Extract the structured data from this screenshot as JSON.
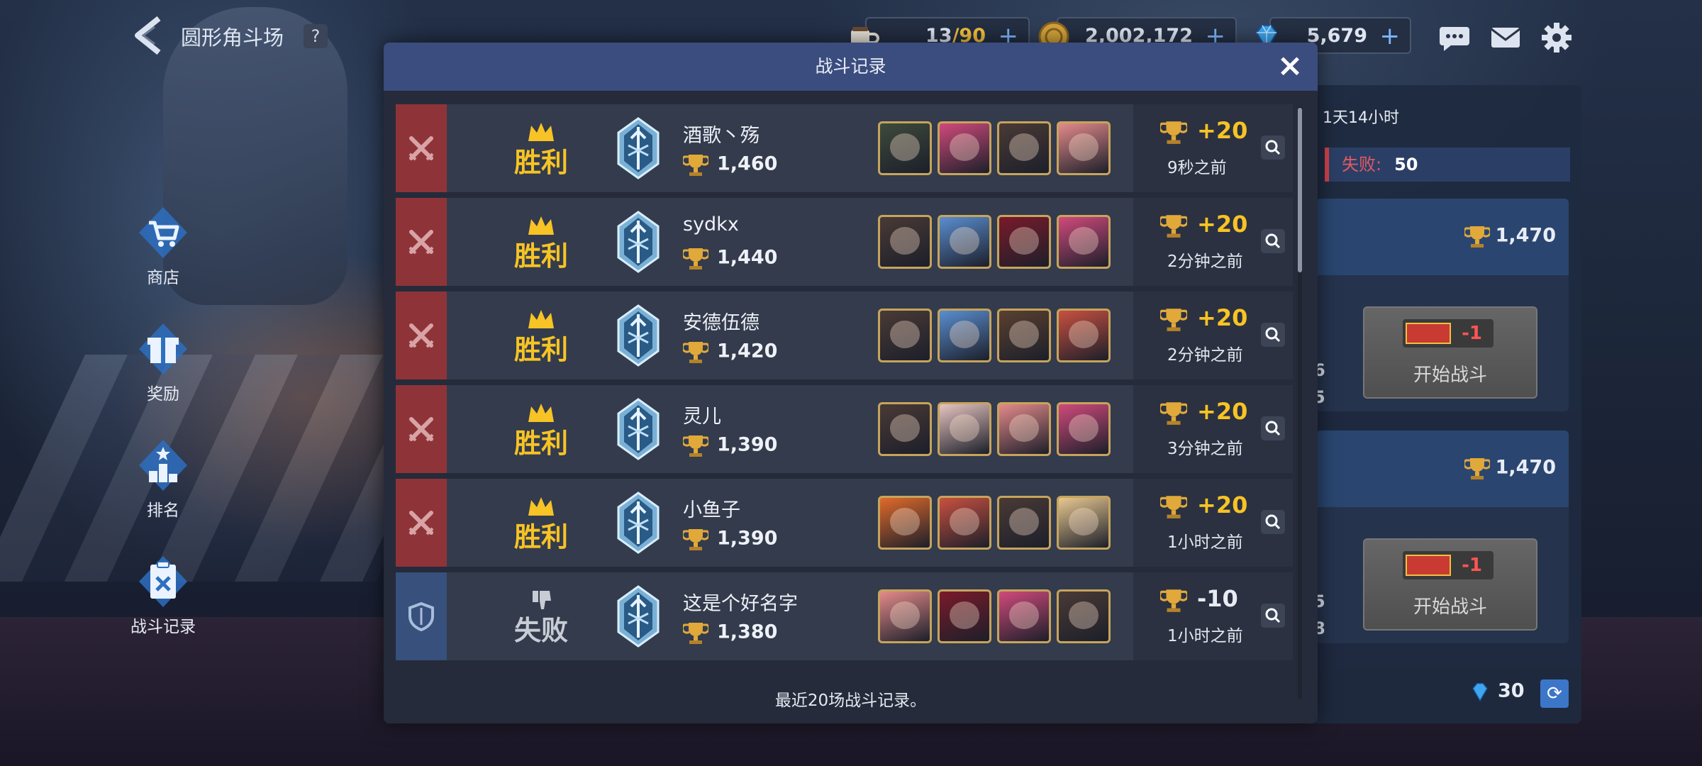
{
  "header": {
    "title": "圆形角斗场",
    "help_label": "?"
  },
  "resources": {
    "stamina_current": "13",
    "stamina_max": "/90",
    "gold": "2,002,172",
    "gems": "5,679",
    "plus": "+"
  },
  "nav": {
    "items": [
      {
        "label": "商店",
        "icon": "cart-icon"
      },
      {
        "label": "奖励",
        "icon": "gift-icon"
      },
      {
        "label": "排名",
        "icon": "podium-icon"
      },
      {
        "label": "战斗记录",
        "icon": "battle-log-icon"
      }
    ]
  },
  "right_panel": {
    "timer": "1天14小时",
    "loss_label": "失败:",
    "loss_value": "50",
    "cards": [
      {
        "score": "1,470",
        "cost": "-1",
        "button": "开始战斗",
        "side_a": "6",
        "side_b": "5"
      },
      {
        "score": "1,470",
        "cost": "-1",
        "button": "开始战斗",
        "side_a": "5",
        "side_b": "8"
      }
    ],
    "gems": "30"
  },
  "dialog": {
    "title": "战斗记录",
    "footer": "最近20场战斗记录。",
    "rows": [
      {
        "outcome": "win",
        "result": "胜利",
        "name": "酒歌丶殇",
        "score": "1,460",
        "delta": "+20",
        "time": "9秒之前",
        "avatars": [
          "#3e4a3c",
          "#d04a7c",
          "#4a3a36",
          "#e48a8a"
        ]
      },
      {
        "outcome": "win",
        "result": "胜利",
        "name": "sydkx",
        "score": "1,440",
        "delta": "+20",
        "time": "2分钟之前",
        "avatars": [
          "#4a3a36",
          "#5a8ed0",
          "#7a1a2a",
          "#d04a7c"
        ]
      },
      {
        "outcome": "win",
        "result": "胜利",
        "name": "安德伍德",
        "score": "1,420",
        "delta": "+20",
        "time": "2分钟之前",
        "avatars": [
          "#4a3a36",
          "#5a8ed0",
          "#5a4030",
          "#c85040"
        ]
      },
      {
        "outcome": "win",
        "result": "胜利",
        "name": "灵儿",
        "score": "1,390",
        "delta": "+20",
        "time": "3分钟之前",
        "avatars": [
          "#4a3a36",
          "#e6c4c0",
          "#e48a8a",
          "#d04a7c"
        ]
      },
      {
        "outcome": "win",
        "result": "胜利",
        "name": "小鱼子",
        "score": "1,390",
        "delta": "+20",
        "time": "1小时之前",
        "avatars": [
          "#e06a2a",
          "#c85040",
          "#4a3a36",
          "#e8c890"
        ]
      },
      {
        "outcome": "loss",
        "result": "失败",
        "name": "这是个好名字",
        "score": "1,380",
        "delta": "-10",
        "time": "1小时之前",
        "avatars": [
          "#e48a8a",
          "#7a1a2a",
          "#d04a7c",
          "#4a3a36"
        ]
      }
    ]
  }
}
